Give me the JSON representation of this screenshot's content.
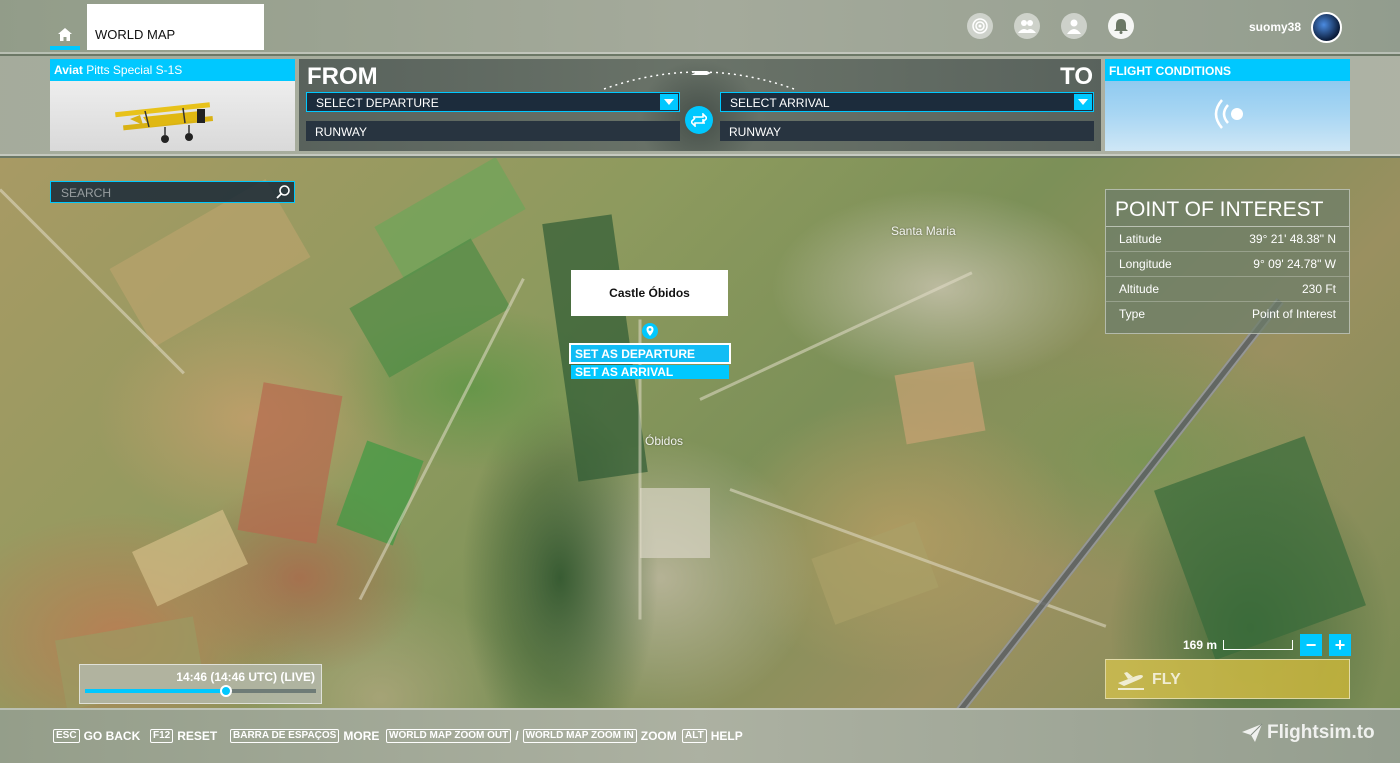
{
  "topbar": {
    "tab_title": "WORLD MAP",
    "username": "suomy38",
    "icons": [
      "home-icon",
      "activity-icon",
      "friends-icon",
      "profile-icon",
      "notifications-icon"
    ]
  },
  "aircraft": {
    "brand": "Aviat",
    "model": "Pitts Special S-1S"
  },
  "route": {
    "from_label": "FROM",
    "to_label": "TO",
    "departure_placeholder": "SELECT DEPARTURE",
    "arrival_placeholder": "SELECT ARRIVAL",
    "departure_runway": "RUNWAY",
    "arrival_runway": "RUNWAY"
  },
  "conditions": {
    "title": "FLIGHT CONDITIONS"
  },
  "search": {
    "placeholder": "SEARCH"
  },
  "poi": {
    "title": "POINT OF INTEREST",
    "rows": [
      {
        "label": "Latitude",
        "value": "39° 21' 48.38\" N"
      },
      {
        "label": "Longitude",
        "value": "9° 09' 24.78\" W"
      },
      {
        "label": "Altitude",
        "value": "230 Ft"
      },
      {
        "label": "Type",
        "value": "Point of Interest"
      }
    ]
  },
  "popup": {
    "name": "Castle Óbidos",
    "set_departure": "SET AS DEPARTURE",
    "set_arrival": "SET AS ARRIVAL"
  },
  "map": {
    "labels": [
      "Santa Maria",
      "Óbidos"
    ]
  },
  "time": {
    "text": "14:46 (14:46 UTC) (LIVE)",
    "progress": 0.61
  },
  "scale": {
    "label": "169 m"
  },
  "zoom": {
    "minus": "−",
    "plus": "+"
  },
  "fly": {
    "label": "FLY"
  },
  "footer": {
    "hints": [
      {
        "key": "ESC",
        "action": "GO BACK"
      },
      {
        "key": "F12",
        "action": "RESET"
      },
      {
        "key": "BARRA DE ESPAÇOS",
        "action": "MORE"
      },
      {
        "key": "WORLD MAP ZOOM OUT",
        "separator": "/"
      },
      {
        "key": "WORLD MAP ZOOM IN",
        "action": "ZOOM"
      },
      {
        "key": "ALT",
        "action": "HELP"
      }
    ],
    "watermark": "Flightsim.to"
  },
  "colors": {
    "accent": "#00c8ff",
    "fly": "#c8b950"
  }
}
